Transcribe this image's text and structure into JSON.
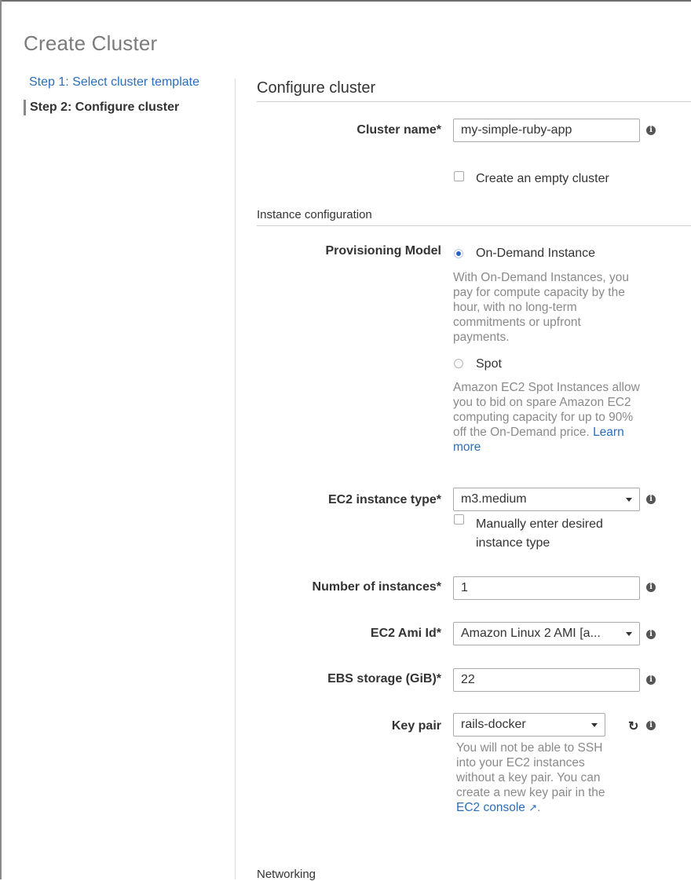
{
  "page": {
    "title": "Create Cluster"
  },
  "steps": [
    {
      "label": "Step 1: Select cluster template"
    },
    {
      "label": "Step 2: Configure cluster"
    }
  ],
  "configure": {
    "title": "Configure cluster",
    "cluster_name": {
      "label": "Cluster name*",
      "value": "my-simple-ruby-app"
    },
    "empty_cluster": {
      "label": "Create an empty cluster",
      "checked": false
    }
  },
  "instance_config": {
    "title": "Instance configuration",
    "provisioning": {
      "label": "Provisioning Model",
      "options": [
        {
          "label": "On-Demand Instance",
          "selected": true,
          "help": "With On-Demand Instances, you pay for compute capacity by the hour, with no long-term commitments or upfront payments."
        },
        {
          "label": "Spot",
          "selected": false,
          "help": "Amazon EC2 Spot Instances allow you to bid on spare Amazon EC2 computing capacity for up to 90% off the On-Demand price.",
          "link": "Learn more"
        }
      ]
    },
    "instance_type": {
      "label": "EC2 instance type*",
      "value": "m3.medium"
    },
    "manual_type": {
      "label_line1": "Manually enter desired",
      "label_line2": "instance type",
      "checked": false
    },
    "num_instances": {
      "label": "Number of instances*",
      "value": "1"
    },
    "ami": {
      "label": "EC2 Ami Id*",
      "value": "Amazon Linux 2 AMI [a..."
    },
    "ebs": {
      "label": "EBS storage (GiB)*",
      "value": "22"
    },
    "key_pair": {
      "label": "Key pair",
      "value": "rails-docker",
      "help_text": "You will not be able to SSH into your EC2 instances without a key pair. You can create a new key pair in the",
      "link": "EC2 console",
      "help_end": "."
    }
  },
  "networking": {
    "title": "Networking"
  },
  "icons": {
    "info": "i",
    "refresh": "↻",
    "external": "↗"
  },
  "colors": {
    "link": "#2a6ebb",
    "radio_selected": "#2a63c6"
  }
}
